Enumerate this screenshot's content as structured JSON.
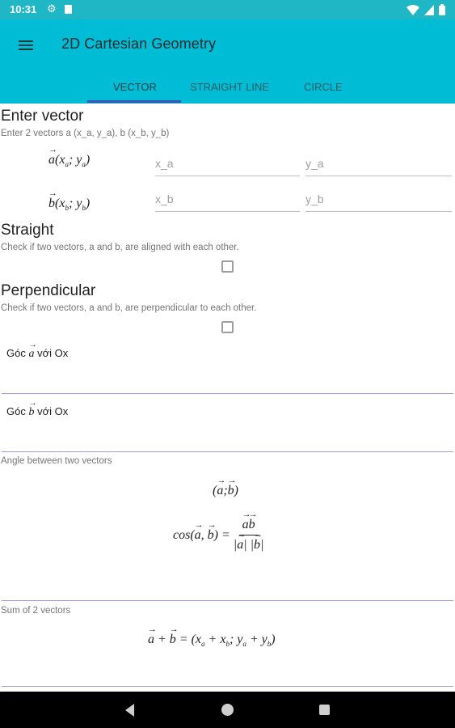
{
  "status_bar": {
    "time": "10:31",
    "icons": [
      "gear-icon",
      "sd-card-icon",
      "wifi-icon",
      "signal-icon",
      "battery-icon"
    ]
  },
  "app_bar": {
    "title": "2D Cartesian Geometry",
    "tabs": [
      {
        "label": "VECTOR",
        "active": true
      },
      {
        "label": "STRAIGHT LINE",
        "active": false
      },
      {
        "label": "CIRCLE",
        "active": false
      }
    ],
    "accent": "#00bcd4",
    "indicator_color": "#3f51b5"
  },
  "enter_vector": {
    "title": "Enter vector",
    "subtitle": "Enter 2 vectors a (x_a, y_a), b (x_b, y_b)",
    "vector_a": {
      "x_placeholder": "x_a",
      "y_placeholder": "y_a"
    },
    "vector_b": {
      "x_placeholder": "x_b",
      "y_placeholder": "y_b"
    }
  },
  "straight": {
    "title": "Straight",
    "subtitle": "Check if two vectors, a and b, are aligned with each other.",
    "checked": false
  },
  "perpendicular": {
    "title": "Perpendicular",
    "subtitle": "Check if two vectors, a and b, are perpendicular to each other.",
    "checked": false
  },
  "angles": {
    "goc": "Góc",
    "voi_ox": "với Ox"
  },
  "angle_between": {
    "label": "Angle between two vectors"
  },
  "sum": {
    "label": "Sum of 2 vectors"
  }
}
